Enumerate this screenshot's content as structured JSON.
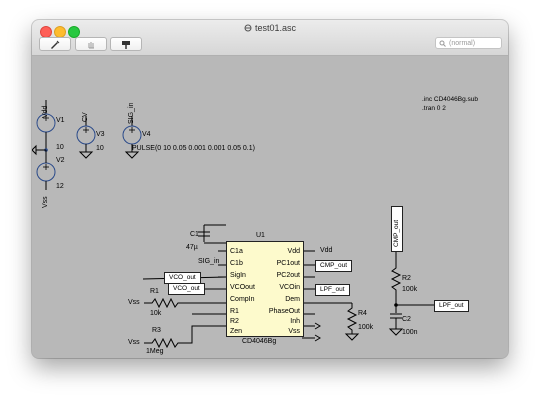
{
  "window": {
    "title": "test01.asc",
    "toolbar": {
      "search_placeholder": "(normal)"
    }
  },
  "directives": {
    "include": ".inc CD4046Bg.sub",
    "tran": ".tran 0 2"
  },
  "sources": {
    "v1": {
      "name": "V1",
      "net": "Vdd",
      "value": "10"
    },
    "v2": {
      "name": "V2",
      "net": "Vss",
      "value": "12"
    },
    "v3": {
      "name": "V3",
      "net": "CV",
      "value": "10"
    },
    "v4": {
      "name": "V4",
      "net": "SIG_in",
      "value": "PULSE(0 10 0.05 0.001 0.001 0.05 0.1)"
    }
  },
  "chip": {
    "ref": "U1",
    "model": "CD4046Bg",
    "left_pins": [
      "C1a",
      "C1b",
      "SigIn",
      "VCOout",
      "CompIn",
      "R1",
      "R2",
      "Zen"
    ],
    "right_pins": [
      "Vdd",
      "PC1out",
      "PC2out",
      "VCOin",
      "Dem",
      "PhaseOut",
      "Inh",
      "Vss"
    ]
  },
  "components": {
    "c1": {
      "name": "C1",
      "value": "47µ"
    },
    "r1": {
      "name": "R1",
      "value": "10k"
    },
    "r3": {
      "name": "R3",
      "value": "1Meg"
    },
    "r4": {
      "name": "R4",
      "value": "100k"
    },
    "r2": {
      "name": "R2",
      "value": "100k"
    },
    "c2": {
      "name": "C2",
      "value": "100n"
    }
  },
  "nets": {
    "sig_in": "SIG_in",
    "vco_out": "VCO_out",
    "vss": "Vss",
    "vdd": "Vdd",
    "cmp_out": "CMP_out",
    "lpf_out": "LPF_out"
  }
}
